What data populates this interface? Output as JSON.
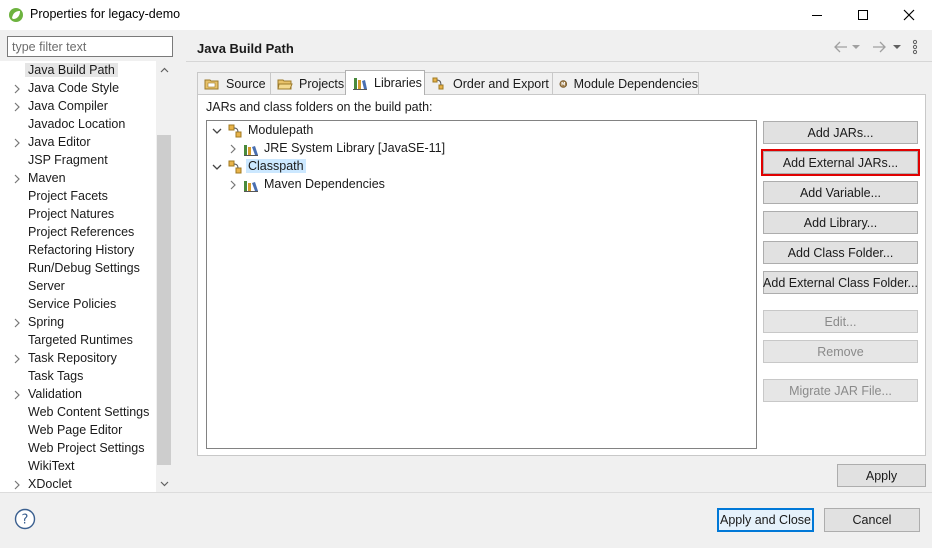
{
  "window": {
    "title": "Properties for legacy-demo",
    "minimize_label": "",
    "maximize_label": "",
    "close_label": ""
  },
  "filter": {
    "placeholder": "type filter text",
    "value": ""
  },
  "nav": {
    "items": [
      {
        "label": "Java Build Path",
        "expandable": false,
        "selected": true
      },
      {
        "label": "Java Code Style",
        "expandable": true
      },
      {
        "label": "Java Compiler",
        "expandable": true
      },
      {
        "label": "Javadoc Location",
        "expandable": false
      },
      {
        "label": "Java Editor",
        "expandable": true
      },
      {
        "label": "JSP Fragment",
        "expandable": false
      },
      {
        "label": "Maven",
        "expandable": true
      },
      {
        "label": "Project Facets",
        "expandable": false
      },
      {
        "label": "Project Natures",
        "expandable": false
      },
      {
        "label": "Project References",
        "expandable": false
      },
      {
        "label": "Refactoring History",
        "expandable": false
      },
      {
        "label": "Run/Debug Settings",
        "expandable": false
      },
      {
        "label": "Server",
        "expandable": false
      },
      {
        "label": "Service Policies",
        "expandable": false
      },
      {
        "label": "Spring",
        "expandable": true
      },
      {
        "label": "Targeted Runtimes",
        "expandable": false
      },
      {
        "label": "Task Repository",
        "expandable": true
      },
      {
        "label": "Task Tags",
        "expandable": false
      },
      {
        "label": "Validation",
        "expandable": true
      },
      {
        "label": "Web Content Settings",
        "expandable": false
      },
      {
        "label": "Web Page Editor",
        "expandable": false
      },
      {
        "label": "Web Project Settings",
        "expandable": false
      },
      {
        "label": "WikiText",
        "expandable": false
      },
      {
        "label": "XDoclet",
        "expandable": true
      }
    ]
  },
  "page": {
    "title": "Java Build Path"
  },
  "tabs": [
    {
      "label": "Source",
      "icon": "source-folder-icon"
    },
    {
      "label": "Projects",
      "icon": "projects-folder-icon"
    },
    {
      "label": "Libraries",
      "icon": "libraries-icon",
      "active": true
    },
    {
      "label": "Order and Export",
      "icon": "order-export-icon"
    },
    {
      "label": "Module Dependencies",
      "icon": "module-icon"
    }
  ],
  "libraries": {
    "description": "JARs and class folders on the build path:",
    "tree": [
      {
        "label": "Modulepath",
        "level": 0,
        "expanded": true,
        "icon": "modulepath-icon"
      },
      {
        "label": "JRE System Library [JavaSE-11]",
        "level": 1,
        "expanded": false,
        "icon": "library-icon"
      },
      {
        "label": "Classpath",
        "level": 0,
        "expanded": true,
        "icon": "classpath-icon",
        "selected": true
      },
      {
        "label": "Maven Dependencies",
        "level": 1,
        "expanded": false,
        "icon": "library-icon"
      }
    ]
  },
  "buttons": {
    "add_jars": "Add JARs...",
    "add_external_jars": "Add External JARs...",
    "add_variable": "Add Variable...",
    "add_library": "Add Library...",
    "add_class_folder": "Add Class Folder...",
    "add_external_class_folder": "Add External Class Folder...",
    "edit": "Edit...",
    "remove": "Remove",
    "migrate_jar": "Migrate JAR File...",
    "apply": "Apply"
  },
  "footer": {
    "apply_and_close": "Apply and Close",
    "cancel": "Cancel"
  },
  "colors": {
    "highlight_border": "#e00000",
    "selection": "#cce8ff",
    "default_button_border": "#0078d7"
  }
}
